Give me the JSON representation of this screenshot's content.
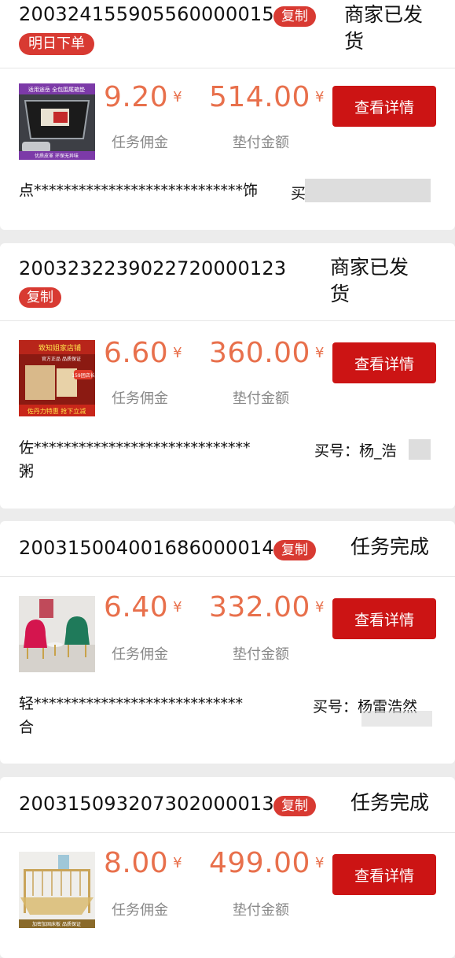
{
  "orders": [
    {
      "order_no": "20032415590556000001",
      "order_no_cut": "5",
      "copy_label": "复制",
      "status_line1": "商家已发",
      "status_line2": "货",
      "tag": "明日下单",
      "commission": "9.20",
      "commission_unit": "¥",
      "commission_label": "任务佣金",
      "advance": "514.00",
      "advance_unit": "¥",
      "advance_label": "垫付金额",
      "detail_label": "查看详情",
      "shop_line1": "点****************************饰",
      "shop_line2": "",
      "buyer": "买"
    },
    {
      "order_no": "20032322390227200001",
      "order_no_cut": "23",
      "copy_label": "复制",
      "status_line1": "商家已发",
      "status_line2": "货",
      "commission": "6.60",
      "commission_unit": "¥",
      "commission_label": "任务佣金",
      "advance": "360.00",
      "advance_unit": "¥",
      "advance_label": "垫付金额",
      "detail_label": "查看详情",
      "shop_line1": "佐*****************************",
      "shop_line2": "粥",
      "buyer": "买号：杨_浩"
    },
    {
      "order_no": "20031500400168600001",
      "order_no_cut": "4",
      "copy_label": "复制",
      "status_line1": "任务完成",
      "commission": "6.40",
      "commission_unit": "¥",
      "commission_label": "任务佣金",
      "advance": "332.00",
      "advance_unit": "¥",
      "advance_label": "垫付金额",
      "detail_label": "查看详情",
      "shop_line1": "轻****************************",
      "shop_line2": "合",
      "buyer": "买号：杨雷浩然"
    },
    {
      "order_no": "20031509320730200001",
      "order_no_cut": "3",
      "copy_label": "复制",
      "status_line1": "任务完成",
      "commission": "8.00",
      "commission_unit": "¥",
      "commission_label": "任务佣金",
      "advance": "499.00",
      "advance_unit": "¥",
      "advance_label": "垫付金额",
      "detail_label": "查看详情"
    }
  ],
  "thumbs": {
    "t1_text_top": "适用途岳 全包围尾箱垫",
    "t1_text_bottom": "优质皮革 环保无异味",
    "t2_header": "致知姐家店铺",
    "t2_sub": "官方正品 品质保证",
    "t2_badge": "159团店长",
    "t2_footer": "佐丹力特惠 抢下立减",
    "t4_footer": "加密加固床板 品质保证"
  },
  "colors": {
    "accent": "#d83a32",
    "button": "#cc1414",
    "amount": "#e8704c"
  }
}
